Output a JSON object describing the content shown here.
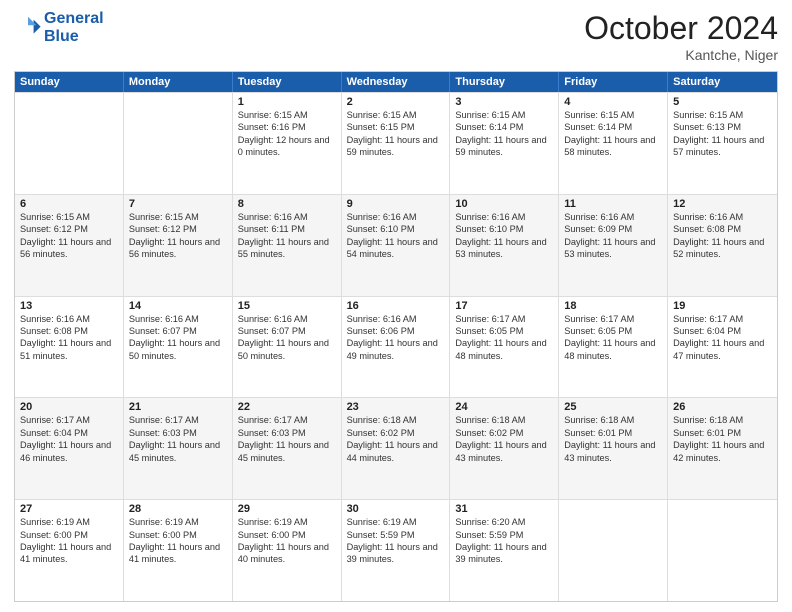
{
  "logo": {
    "line1": "General",
    "line2": "Blue"
  },
  "title": "October 2024",
  "location": "Kantche, Niger",
  "days_of_week": [
    "Sunday",
    "Monday",
    "Tuesday",
    "Wednesday",
    "Thursday",
    "Friday",
    "Saturday"
  ],
  "weeks": [
    [
      {
        "day": "",
        "sunrise": "",
        "sunset": "",
        "daylight": ""
      },
      {
        "day": "",
        "sunrise": "",
        "sunset": "",
        "daylight": ""
      },
      {
        "day": "1",
        "sunrise": "Sunrise: 6:15 AM",
        "sunset": "Sunset: 6:16 PM",
        "daylight": "Daylight: 12 hours and 0 minutes."
      },
      {
        "day": "2",
        "sunrise": "Sunrise: 6:15 AM",
        "sunset": "Sunset: 6:15 PM",
        "daylight": "Daylight: 11 hours and 59 minutes."
      },
      {
        "day": "3",
        "sunrise": "Sunrise: 6:15 AM",
        "sunset": "Sunset: 6:14 PM",
        "daylight": "Daylight: 11 hours and 59 minutes."
      },
      {
        "day": "4",
        "sunrise": "Sunrise: 6:15 AM",
        "sunset": "Sunset: 6:14 PM",
        "daylight": "Daylight: 11 hours and 58 minutes."
      },
      {
        "day": "5",
        "sunrise": "Sunrise: 6:15 AM",
        "sunset": "Sunset: 6:13 PM",
        "daylight": "Daylight: 11 hours and 57 minutes."
      }
    ],
    [
      {
        "day": "6",
        "sunrise": "Sunrise: 6:15 AM",
        "sunset": "Sunset: 6:12 PM",
        "daylight": "Daylight: 11 hours and 56 minutes."
      },
      {
        "day": "7",
        "sunrise": "Sunrise: 6:15 AM",
        "sunset": "Sunset: 6:12 PM",
        "daylight": "Daylight: 11 hours and 56 minutes."
      },
      {
        "day": "8",
        "sunrise": "Sunrise: 6:16 AM",
        "sunset": "Sunset: 6:11 PM",
        "daylight": "Daylight: 11 hours and 55 minutes."
      },
      {
        "day": "9",
        "sunrise": "Sunrise: 6:16 AM",
        "sunset": "Sunset: 6:10 PM",
        "daylight": "Daylight: 11 hours and 54 minutes."
      },
      {
        "day": "10",
        "sunrise": "Sunrise: 6:16 AM",
        "sunset": "Sunset: 6:10 PM",
        "daylight": "Daylight: 11 hours and 53 minutes."
      },
      {
        "day": "11",
        "sunrise": "Sunrise: 6:16 AM",
        "sunset": "Sunset: 6:09 PM",
        "daylight": "Daylight: 11 hours and 53 minutes."
      },
      {
        "day": "12",
        "sunrise": "Sunrise: 6:16 AM",
        "sunset": "Sunset: 6:08 PM",
        "daylight": "Daylight: 11 hours and 52 minutes."
      }
    ],
    [
      {
        "day": "13",
        "sunrise": "Sunrise: 6:16 AM",
        "sunset": "Sunset: 6:08 PM",
        "daylight": "Daylight: 11 hours and 51 minutes."
      },
      {
        "day": "14",
        "sunrise": "Sunrise: 6:16 AM",
        "sunset": "Sunset: 6:07 PM",
        "daylight": "Daylight: 11 hours and 50 minutes."
      },
      {
        "day": "15",
        "sunrise": "Sunrise: 6:16 AM",
        "sunset": "Sunset: 6:07 PM",
        "daylight": "Daylight: 11 hours and 50 minutes."
      },
      {
        "day": "16",
        "sunrise": "Sunrise: 6:16 AM",
        "sunset": "Sunset: 6:06 PM",
        "daylight": "Daylight: 11 hours and 49 minutes."
      },
      {
        "day": "17",
        "sunrise": "Sunrise: 6:17 AM",
        "sunset": "Sunset: 6:05 PM",
        "daylight": "Daylight: 11 hours and 48 minutes."
      },
      {
        "day": "18",
        "sunrise": "Sunrise: 6:17 AM",
        "sunset": "Sunset: 6:05 PM",
        "daylight": "Daylight: 11 hours and 48 minutes."
      },
      {
        "day": "19",
        "sunrise": "Sunrise: 6:17 AM",
        "sunset": "Sunset: 6:04 PM",
        "daylight": "Daylight: 11 hours and 47 minutes."
      }
    ],
    [
      {
        "day": "20",
        "sunrise": "Sunrise: 6:17 AM",
        "sunset": "Sunset: 6:04 PM",
        "daylight": "Daylight: 11 hours and 46 minutes."
      },
      {
        "day": "21",
        "sunrise": "Sunrise: 6:17 AM",
        "sunset": "Sunset: 6:03 PM",
        "daylight": "Daylight: 11 hours and 45 minutes."
      },
      {
        "day": "22",
        "sunrise": "Sunrise: 6:17 AM",
        "sunset": "Sunset: 6:03 PM",
        "daylight": "Daylight: 11 hours and 45 minutes."
      },
      {
        "day": "23",
        "sunrise": "Sunrise: 6:18 AM",
        "sunset": "Sunset: 6:02 PM",
        "daylight": "Daylight: 11 hours and 44 minutes."
      },
      {
        "day": "24",
        "sunrise": "Sunrise: 6:18 AM",
        "sunset": "Sunset: 6:02 PM",
        "daylight": "Daylight: 11 hours and 43 minutes."
      },
      {
        "day": "25",
        "sunrise": "Sunrise: 6:18 AM",
        "sunset": "Sunset: 6:01 PM",
        "daylight": "Daylight: 11 hours and 43 minutes."
      },
      {
        "day": "26",
        "sunrise": "Sunrise: 6:18 AM",
        "sunset": "Sunset: 6:01 PM",
        "daylight": "Daylight: 11 hours and 42 minutes."
      }
    ],
    [
      {
        "day": "27",
        "sunrise": "Sunrise: 6:19 AM",
        "sunset": "Sunset: 6:00 PM",
        "daylight": "Daylight: 11 hours and 41 minutes."
      },
      {
        "day": "28",
        "sunrise": "Sunrise: 6:19 AM",
        "sunset": "Sunset: 6:00 PM",
        "daylight": "Daylight: 11 hours and 41 minutes."
      },
      {
        "day": "29",
        "sunrise": "Sunrise: 6:19 AM",
        "sunset": "Sunset: 6:00 PM",
        "daylight": "Daylight: 11 hours and 40 minutes."
      },
      {
        "day": "30",
        "sunrise": "Sunrise: 6:19 AM",
        "sunset": "Sunset: 5:59 PM",
        "daylight": "Daylight: 11 hours and 39 minutes."
      },
      {
        "day": "31",
        "sunrise": "Sunrise: 6:20 AM",
        "sunset": "Sunset: 5:59 PM",
        "daylight": "Daylight: 11 hours and 39 minutes."
      },
      {
        "day": "",
        "sunrise": "",
        "sunset": "",
        "daylight": ""
      },
      {
        "day": "",
        "sunrise": "",
        "sunset": "",
        "daylight": ""
      }
    ]
  ]
}
